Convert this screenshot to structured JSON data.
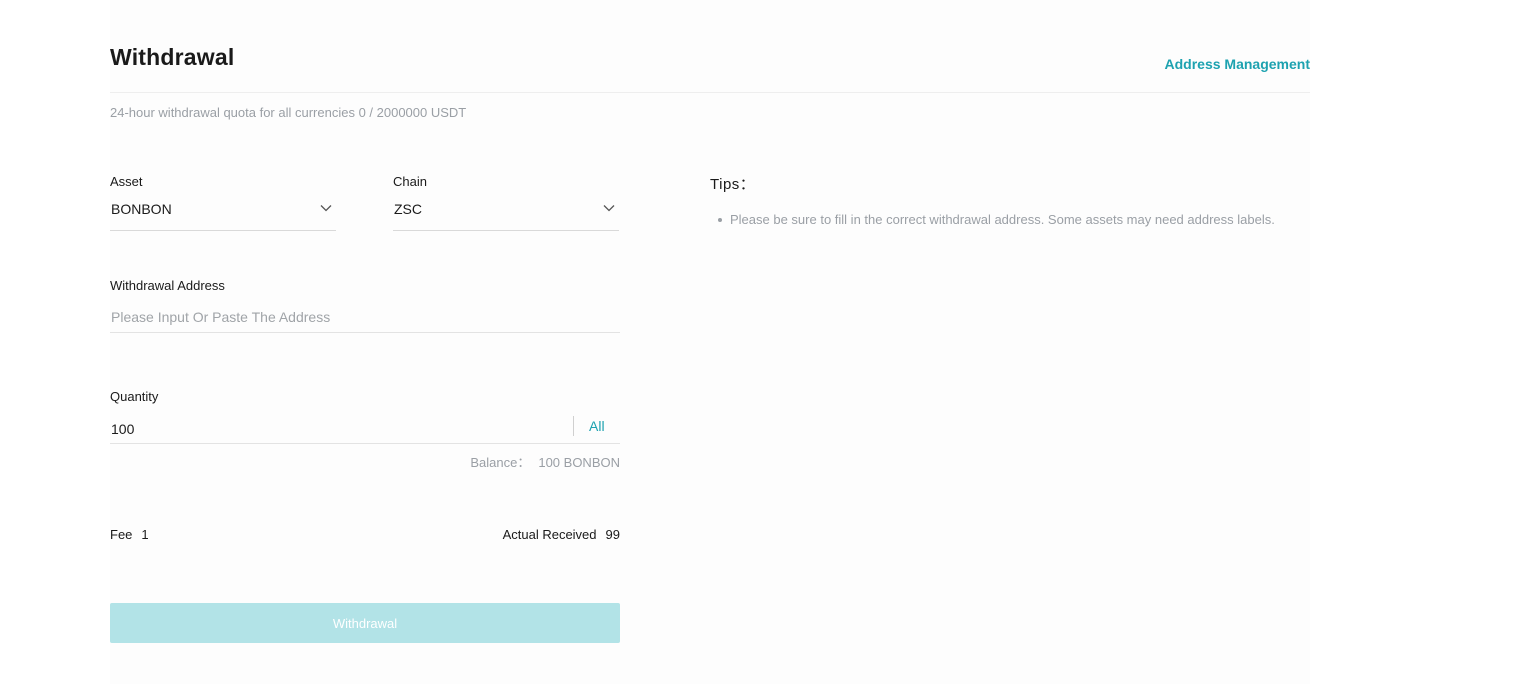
{
  "header": {
    "title": "Withdrawal",
    "address_management": "Address Management"
  },
  "quota": {
    "text": "24-hour withdrawal quota for all currencies 0 / 2000000 USDT"
  },
  "form": {
    "asset": {
      "label": "Asset",
      "value": "BONBON"
    },
    "chain": {
      "label": "Chain",
      "value": "ZSC"
    },
    "address": {
      "label": "Withdrawal Address",
      "value": "",
      "placeholder": "Please Input Or Paste The Address"
    },
    "quantity": {
      "label": "Quantity",
      "value": "100",
      "all_label": "All"
    },
    "balance": {
      "label": "Balance：",
      "value": "100 BONBON"
    },
    "fee": {
      "label": "Fee",
      "value": "1"
    },
    "actual_received": {
      "label": "Actual Received",
      "value": "99"
    },
    "submit_label": "Withdrawal"
  },
  "tips": {
    "title": "Tips：",
    "items": [
      "Please be sure to fill in the correct withdrawal address. Some assets may need address labels."
    ]
  },
  "colors": {
    "accent": "#1da2b0",
    "button_disabled": "#b2e3e7",
    "muted_text": "#9a9fa5"
  },
  "icons": {
    "asset_dropdown": "chevron-down-icon",
    "chain_dropdown": "chevron-down-icon",
    "tip_bullet": "bullet-dot-icon"
  }
}
